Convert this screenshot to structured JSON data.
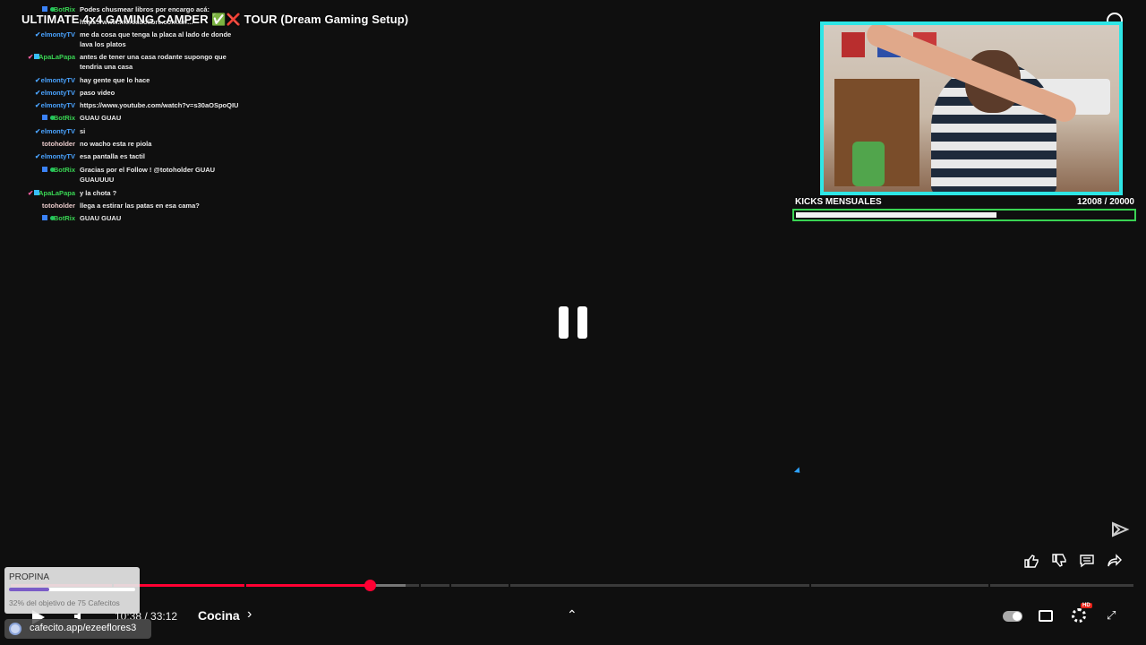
{
  "video": {
    "title": "ULTIMATE 4x4 GAMING CAMPER ✅❌ TOUR (Dream Gaming Setup)",
    "time": "10:38 / 33:12",
    "chapter": "Cocina",
    "progress_fraction": 0.32
  },
  "chat": [
    {
      "user": "BotRix",
      "badges": "bot",
      "color": "#39d353",
      "text": "Podes chusmear libros por encargo acá:"
    },
    {
      "user": "",
      "badges": "",
      "color": "#ffffff",
      "text": "https://www.mercadolibre.com.ar/..."
    },
    {
      "user": "elmontyTV",
      "badges": "check",
      "color": "#4aa3ff",
      "text": "me da cosa que tenga la placa al lado de donde lava los platos"
    },
    {
      "user": "ApaLaPapa",
      "badges": "checkmod",
      "color": "#39d353",
      "text": "antes de tener una casa rodante supongo que tendria una casa"
    },
    {
      "user": "elmontyTV",
      "badges": "check",
      "color": "#4aa3ff",
      "text": "hay gente que lo hace"
    },
    {
      "user": "elmontyTV",
      "badges": "check",
      "color": "#4aa3ff",
      "text": "paso video"
    },
    {
      "user": "elmontyTV",
      "badges": "check",
      "color": "#4aa3ff",
      "text": "https://www.youtube.com/watch?v=s30aOSpoQIU"
    },
    {
      "user": "BotRix",
      "badges": "bot",
      "color": "#39d353",
      "text": "GUAU GUAU"
    },
    {
      "user": "elmontyTV",
      "badges": "check",
      "color": "#4aa3ff",
      "text": "si"
    },
    {
      "user": "totoholder",
      "badges": "",
      "color": "#e8c9c9",
      "text": "no wacho esta re piola"
    },
    {
      "user": "elmontyTV",
      "badges": "check",
      "color": "#4aa3ff",
      "text": "esa pantalla es tactil"
    },
    {
      "user": "BotRix",
      "badges": "bot",
      "color": "#39d353",
      "text": "Gracias por el Follow ! @totoholder GUAU GUAUUUU"
    },
    {
      "user": "ApaLaPapa",
      "badges": "checkmod",
      "color": "#39d353",
      "text": "y la chota ?"
    },
    {
      "user": "totoholder",
      "badges": "",
      "color": "#e8c9c9",
      "text": "llega a estirar las patas en esa cama?"
    },
    {
      "user": "BotRix",
      "badges": "bot",
      "color": "#39d353",
      "text": "GUAU GUAU"
    }
  ],
  "kicks": {
    "label": "KICKS MENSUALES",
    "value": "12008  / 20000",
    "fraction": 0.6
  },
  "tip": {
    "title": "PROPINA",
    "goal": "32% del objetivo de 75 Cafecitos",
    "fraction": 0.32
  },
  "cafecito": {
    "link": "cafecito.app/ezeeflores3"
  },
  "settings": {
    "quality_badge": "HD"
  },
  "icons": {
    "like": "like-icon",
    "dislike": "dislike-icon",
    "comment": "comment-icon",
    "share": "share-icon"
  }
}
